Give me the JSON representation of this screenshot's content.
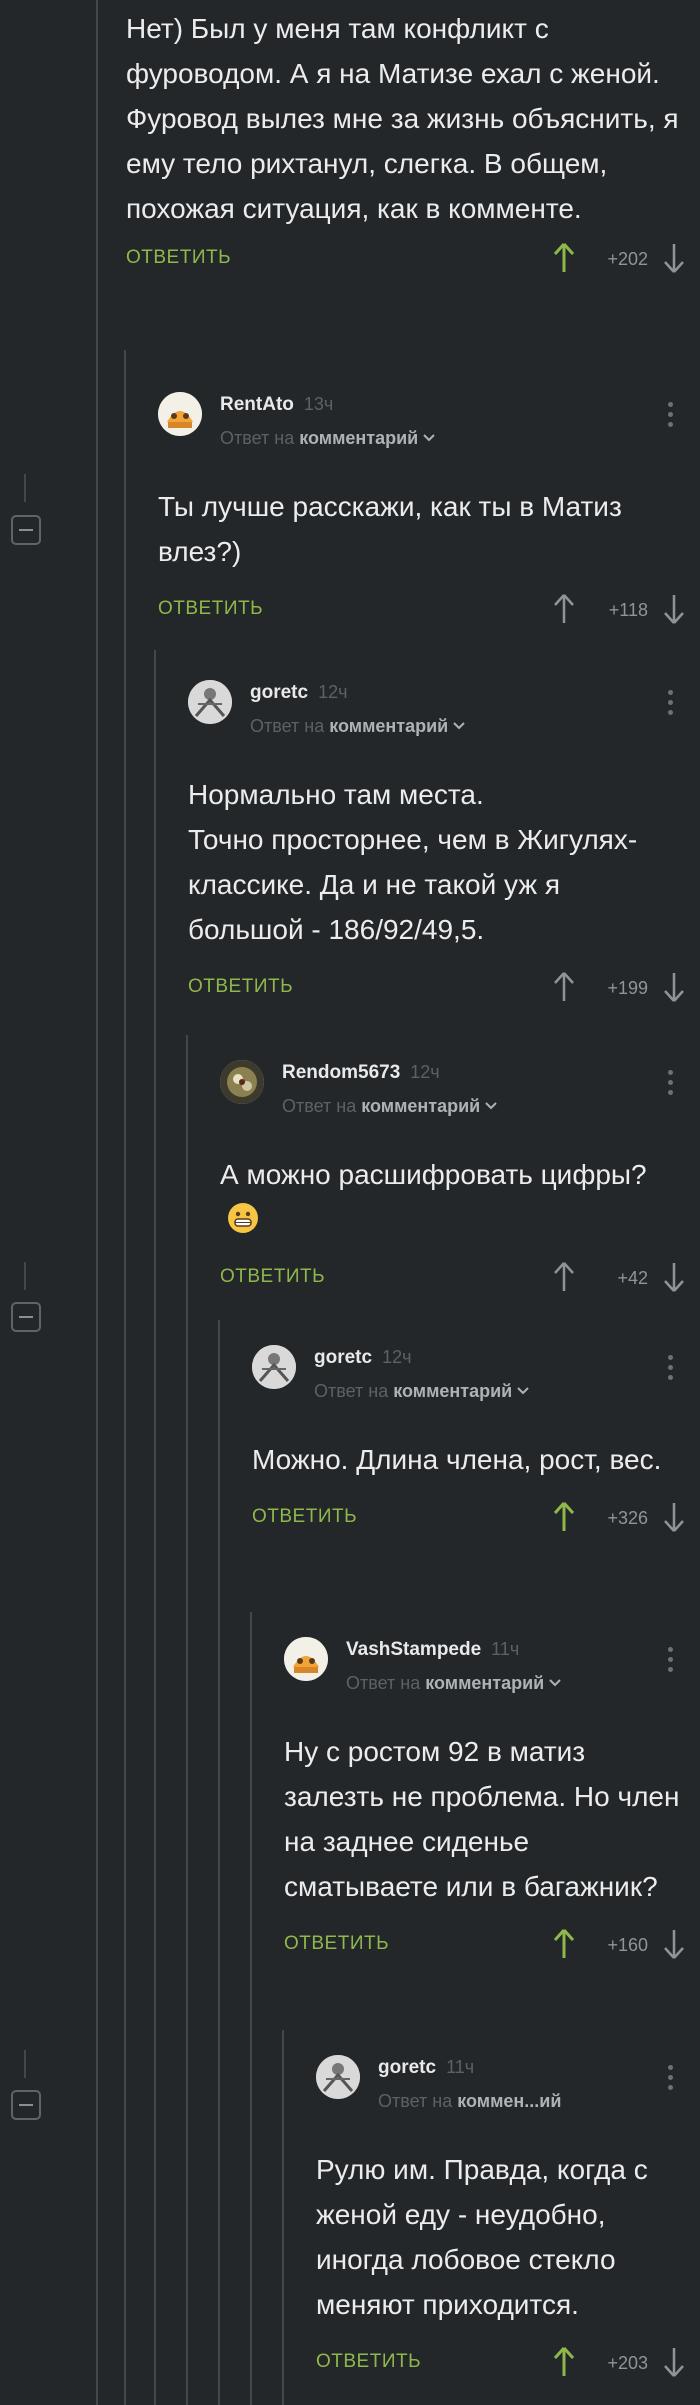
{
  "top": {
    "text": "Нет) Был у меня там конфликт с фуроводом. А я на Матизе ехал с женой. Фуровод вылез мне за жизнь объяснить, я ему тело рихтанул, слегка. В общем, похожая ситуация, как в комменте.",
    "reply_label": "ОТВЕТИТЬ",
    "score": "+202"
  },
  "comments": [
    {
      "user": "RentAto",
      "time": "13ч",
      "reply_prefix": "Ответ на",
      "reply_target": "комментарий",
      "text": "Ты лучше расскажи, как ты в Матиз влез?)",
      "reply_label": "ОТВЕТИТЬ",
      "score": "+118"
    },
    {
      "user": "goretc",
      "time": "12ч",
      "reply_prefix": "Ответ на",
      "reply_target": "комментарий",
      "text": "Нормально там места.\nТочно просторнее, чем в Жигулях-классике. Да и не такой уж я большой - 186/92/49,5.",
      "reply_label": "ОТВЕТИТЬ",
      "score": "+199"
    },
    {
      "user": "Rendom5673",
      "time": "12ч",
      "reply_prefix": "Ответ на",
      "reply_target": "комментарий",
      "text": "А можно расшифровать цифры?",
      "reply_label": "ОТВЕТИТЬ",
      "score": "+42"
    },
    {
      "user": "goretc",
      "time": "12ч",
      "reply_prefix": "Ответ на",
      "reply_target": "комментарий",
      "text": "Можно. Длина члена, рост, вес.",
      "reply_label": "ОТВЕТИТЬ",
      "score": "+326"
    },
    {
      "user": "VashStampede",
      "time": "11ч",
      "reply_prefix": "Ответ на",
      "reply_target": "комментарий",
      "text": "Ну с ростом 92 в матиз залезть не проблема. Но член на заднее сиденье сматываете или в багажник?",
      "reply_label": "ОТВЕТИТЬ",
      "score": "+160"
    },
    {
      "user": "goretc",
      "time": "11ч",
      "reply_prefix": "Ответ на",
      "reply_target": "коммен...ий",
      "text": "Рулю им. Правда, когда с женой еду - неудобно, иногда лобовое стекло меняют приходится.",
      "reply_label": "ОТВЕТИТЬ",
      "score": "+203"
    }
  ],
  "colors": {
    "background": "#24272a",
    "accent": "#8fb84b",
    "thread_line": "#43474b",
    "muted": "#5c6166"
  }
}
